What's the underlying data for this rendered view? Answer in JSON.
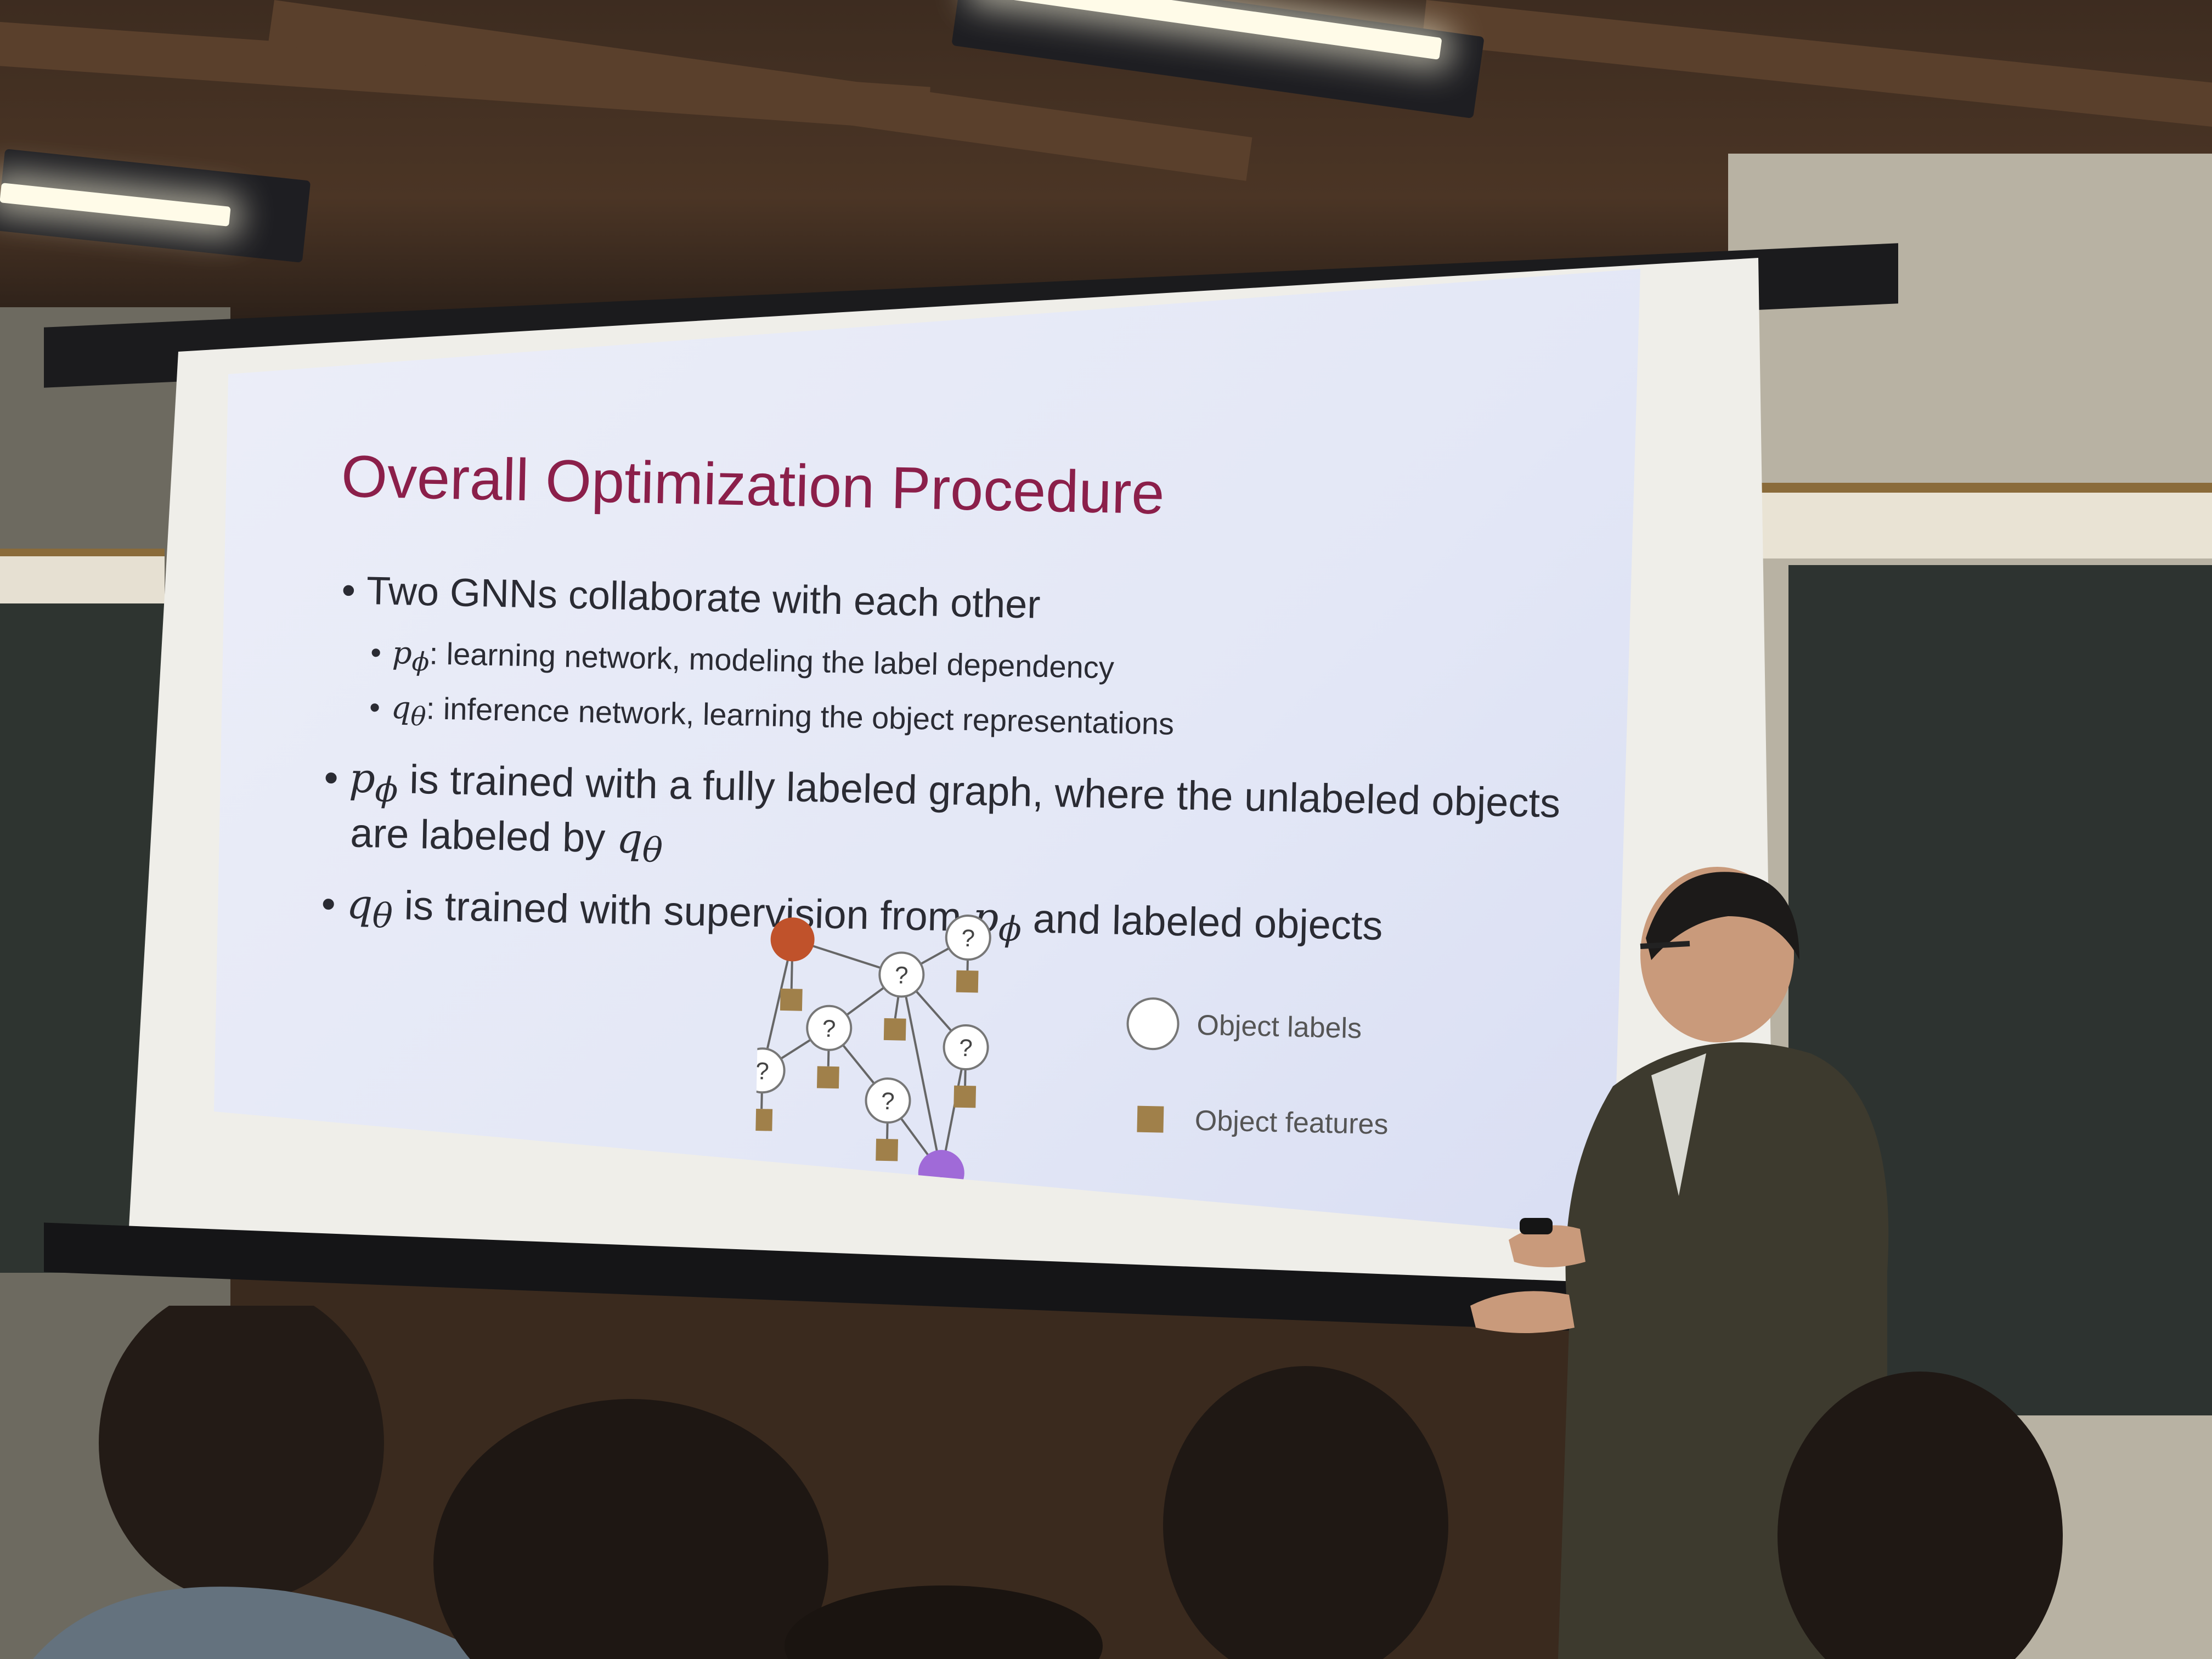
{
  "slide": {
    "title": "Overall Optimization Procedure",
    "bullets": {
      "b1": {
        "text": "Two GNNs collaborate with each other"
      },
      "b1a": {
        "symbol": "p",
        "subscript": "ϕ",
        "text": ": learning network, modeling the label dependency"
      },
      "b1b": {
        "symbol": "q",
        "subscript": "θ",
        "text": ": inference network, learning the object representations"
      },
      "b2": {
        "symbol": "p",
        "subscript": "ϕ",
        "text": " is trained with a fully labeled graph, where the unlabeled objects",
        "line2": "are labeled by ",
        "line2_symbol": "q",
        "line2_subscript": "θ"
      },
      "b3": {
        "symbol": "q",
        "subscript": "θ",
        "text": " is trained with supervision from ",
        "mid_symbol": "p",
        "mid_subscript": "ϕ",
        "tail": " and labeled objects"
      }
    },
    "diagram": {
      "unknown_label": "?",
      "legend": {
        "labels_text": "Object labels",
        "features_text": "Object features"
      },
      "colors": {
        "known_node_a": "#c0522b",
        "known_node_b": "#a06ad8",
        "feature_square": "#a0804a",
        "edge": "#666666"
      }
    }
  },
  "colors": {
    "title": "#8b1f4a",
    "body_text": "#2a2b33",
    "slide_bg": "#e3e7f6"
  }
}
